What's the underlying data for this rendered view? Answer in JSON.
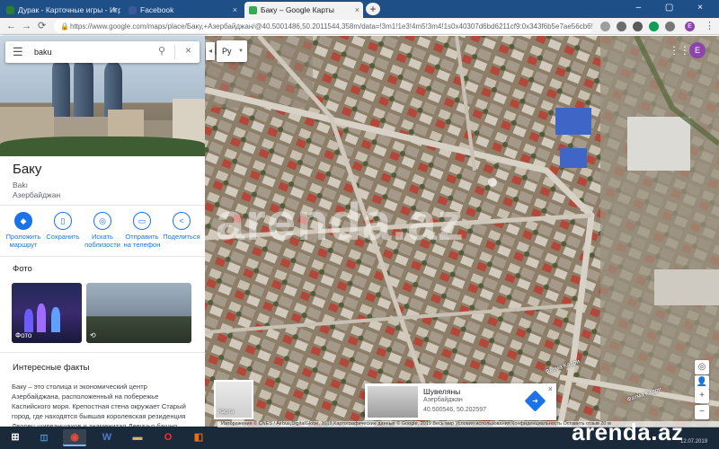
{
  "browser": {
    "tabs": [
      {
        "title": "Дурак - Карточные игры - Игр",
        "favicon_color": "#2e7d32"
      },
      {
        "title": "Facebook",
        "favicon_color": "#3b5998"
      },
      {
        "title": "Баку – Google Карты",
        "favicon_color": "#34a853"
      }
    ],
    "tab_close": "×",
    "new_tab": "+",
    "window_controls": "– ▢ ×",
    "nav": {
      "back": "←",
      "forward": "→",
      "reload": "⟳"
    },
    "url": "https://www.google.com/maps/place/Баку,+Азербайджан/@40.5001486,50.2011544,358m/data=!3m1!1e3!4m5!3m4!1s0x40307d6bd6211cf9:0x343f6b5e7ae56cb6!8",
    "lock_icon": "🔒",
    "profile_initial": "E"
  },
  "search": {
    "menu_icon": "☰",
    "value": "baku",
    "search_icon": "⚲",
    "clear_icon": "×"
  },
  "place": {
    "title": "Баку",
    "subtitle": "Bakı",
    "country": "Азербайджан"
  },
  "actions": [
    {
      "label1": "Проложить",
      "label2": "маршрут",
      "icon": "◆",
      "filled": true
    },
    {
      "label1": "Сохранить",
      "label2": "",
      "icon": "▯",
      "filled": false
    },
    {
      "label1": "Искать",
      "label2": "поблизости",
      "icon": "◎",
      "filled": false
    },
    {
      "label1": "Отправить",
      "label2": "на телефон",
      "icon": "▭",
      "filled": false
    },
    {
      "label1": "Поделиться",
      "label2": "",
      "icon": "<",
      "filled": false
    }
  ],
  "photos": {
    "heading": "Фото",
    "caption": "Фото",
    "street_view_icon": "⟲"
  },
  "facts": {
    "heading": "Интересные факты",
    "text": "Баку – это столица и экономический центр Азербайджана, расположенный на побережье Каспийского моря. Крепостная стена окружает Старый город, где находятся бывшая королевская резиденция Дворец ширваншахов и знаменитая Девичья башня."
  },
  "map": {
    "lang_label": "Ру",
    "collapse_icon": "◂",
    "apps_icon": "⋮⋮⋮",
    "watermark": "arenda.az",
    "minimap_label": "Карта",
    "card": {
      "name": "Шувеляны",
      "country": "Азербайджан",
      "coords": "40.500546, 50.202597",
      "directions_icon": "➜",
      "close_icon": "×"
    },
    "street_label_1": "Фатма Кадри",
    "street_label_2": "Фатма Кадри",
    "controls": {
      "locate": "◎",
      "zoom_in": "+",
      "zoom_out": "−",
      "pegman": "👤"
    },
    "attribution": "Изображения © CNES / Airbus,DigitalGlobe, 2019,Картографические данные © Google, 2019    Весь мир    Условия использования    Конфиденциальность    Оставить отзыв    20 м"
  },
  "taskbar": {
    "apps": [
      {
        "icon": "⊞",
        "color": "#ffffff"
      },
      {
        "icon": "◉",
        "color": "#e74c3c"
      },
      {
        "icon": "W",
        "color": "#2b579a"
      },
      {
        "icon": "▬",
        "color": "#d8b26a"
      },
      {
        "icon": "O",
        "color": "#cc0f16"
      },
      {
        "icon": "◧",
        "color": "#e86c1b"
      }
    ],
    "brand": "arenda.az",
    "clock": "12.07.2019"
  }
}
